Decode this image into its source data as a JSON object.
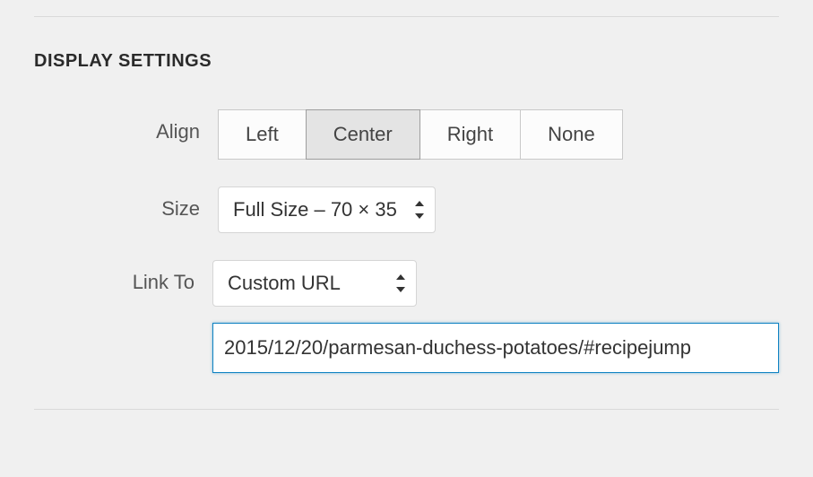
{
  "section_title": "DISPLAY SETTINGS",
  "align": {
    "label": "Align",
    "options": [
      "Left",
      "Center",
      "Right",
      "None"
    ],
    "selected": "Center"
  },
  "size": {
    "label": "Size",
    "value": "Full Size – 70 × 35"
  },
  "link_to": {
    "label": "Link To",
    "value": "Custom URL",
    "url_value": "2015/12/20/parmesan-duchess-potatoes/#recipejump"
  }
}
